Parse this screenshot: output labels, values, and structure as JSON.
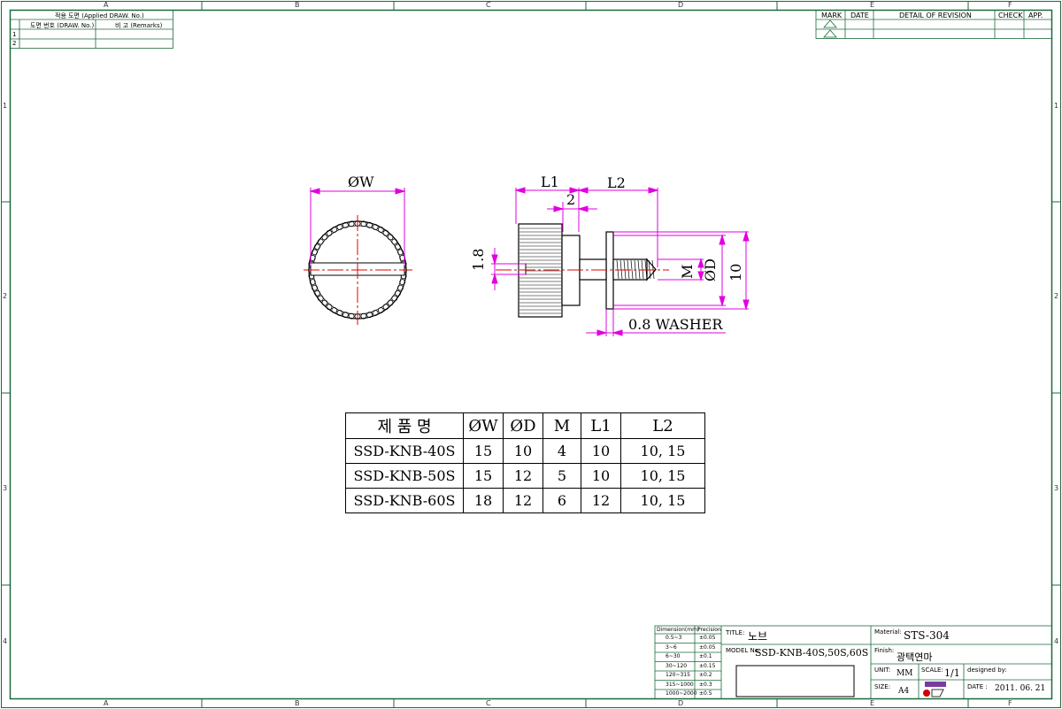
{
  "zones": {
    "columns": [
      "A",
      "B",
      "C",
      "D",
      "E",
      "F"
    ],
    "rows": [
      "1",
      "2",
      "3",
      "4"
    ]
  },
  "applied_block": {
    "header": "적용 도면 (Applied DRAW. No.)",
    "col1": "도면 번호 (DRAW. No.)",
    "col2": "비 고 (Remarks)",
    "row_numbers": [
      "1",
      "2"
    ]
  },
  "revision_block": {
    "mark": "MARK",
    "date": "DATE",
    "detail": "DETAIL OF REVISION",
    "check": "CHECK",
    "app": "APP."
  },
  "drawing": {
    "top_view": {
      "label_w": "ØW"
    },
    "side_view": {
      "label_l1": "L1",
      "label_l2": "L2",
      "label_2": "2",
      "label_18": "1.8",
      "label_m": "M",
      "label_d": "ØD",
      "label_10": "10",
      "label_washer": "0.8 WASHER"
    }
  },
  "spec_table": {
    "headers": [
      "제 품 명",
      "ØW",
      "ØD",
      "M",
      "L1",
      "L2"
    ],
    "rows": [
      [
        "SSD-KNB-40S",
        "15",
        "10",
        "4",
        "10",
        "10, 15"
      ],
      [
        "SSD-KNB-50S",
        "15",
        "12",
        "5",
        "10",
        "10, 15"
      ],
      [
        "SSD-KNB-60S",
        "18",
        "12",
        "6",
        "12",
        "10, 15"
      ]
    ]
  },
  "tolerance_block": {
    "header_dim": "Dimension(mm)",
    "header_prec": "Precision",
    "rows": [
      [
        "0.5~3",
        "±0.05"
      ],
      [
        "3~6",
        "±0.05"
      ],
      [
        "6~30",
        "±0.1"
      ],
      [
        "30~120",
        "±0.15"
      ],
      [
        "120~315",
        "±0.2"
      ],
      [
        "315~1000",
        "±0.3"
      ],
      [
        "1000~2000",
        "±0.5"
      ]
    ]
  },
  "title_block": {
    "title_label": "TITLE:",
    "title_value": "노브",
    "model_label": "MODEL No.",
    "model_value": "SSD-KNB-40S,50S,60S",
    "material_label": "Material:",
    "material_value": "STS-304",
    "finish_label": "Finish:",
    "finish_value": "광택연마",
    "unit_label": "UNIT:",
    "unit_value": "MM",
    "scale_label": "SCALE:",
    "scale_value": "1/1",
    "designed_label": "designed by:",
    "size_label": "SIZE:",
    "size_value": "A4",
    "date_label": "DATE :",
    "date_value": "2011. 06. 21"
  },
  "colors": {
    "frame": "#1a6b3a",
    "dimension": "#e000e0",
    "centerline": "#e00000",
    "outline": "#000000"
  }
}
